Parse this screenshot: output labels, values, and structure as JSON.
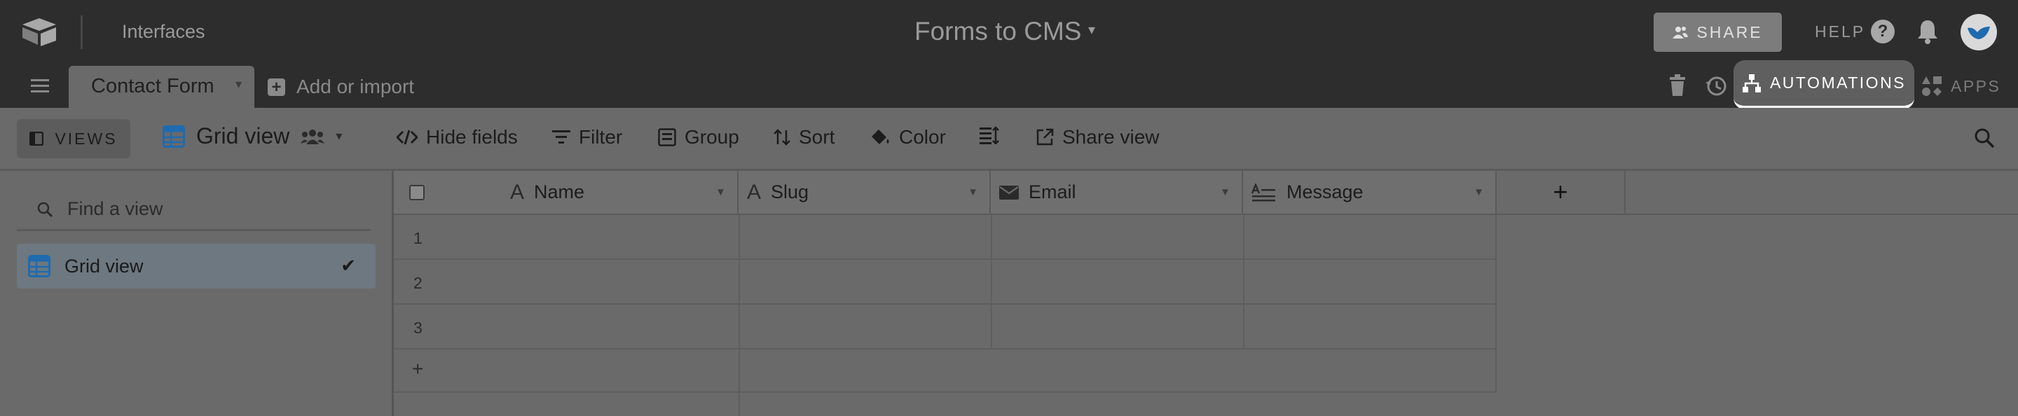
{
  "topbar": {
    "interfaces_label": "Interfaces",
    "base_title": "Forms to CMS",
    "share_label": "SHARE",
    "help_label": "HELP"
  },
  "tabbar": {
    "active_tab": "Contact Form",
    "add_import_label": "Add or import",
    "automations_label": "AUTOMATIONS",
    "apps_label": "APPS"
  },
  "viewbar": {
    "views_label": "VIEWS",
    "current_view": "Grid view",
    "hide_fields": "Hide fields",
    "filter": "Filter",
    "group": "Group",
    "sort": "Sort",
    "color": "Color",
    "share_view": "Share view"
  },
  "sidebar": {
    "find_placeholder": "Find a view",
    "items": [
      {
        "label": "Grid view",
        "selected": true
      }
    ]
  },
  "grid": {
    "columns": [
      {
        "name": "Name",
        "type": "text"
      },
      {
        "name": "Slug",
        "type": "text"
      },
      {
        "name": "Email",
        "type": "email"
      },
      {
        "name": "Message",
        "type": "long-text"
      }
    ],
    "rows": [
      "1",
      "2",
      "3"
    ],
    "add_column": "+",
    "add_row": "+"
  },
  "colors": {
    "topbar_bg": "#2d2d2d",
    "content_bg": "#6a6a6a",
    "grid_icon": "#1f6bb0",
    "avatar_accent": "#1f6bb0"
  }
}
